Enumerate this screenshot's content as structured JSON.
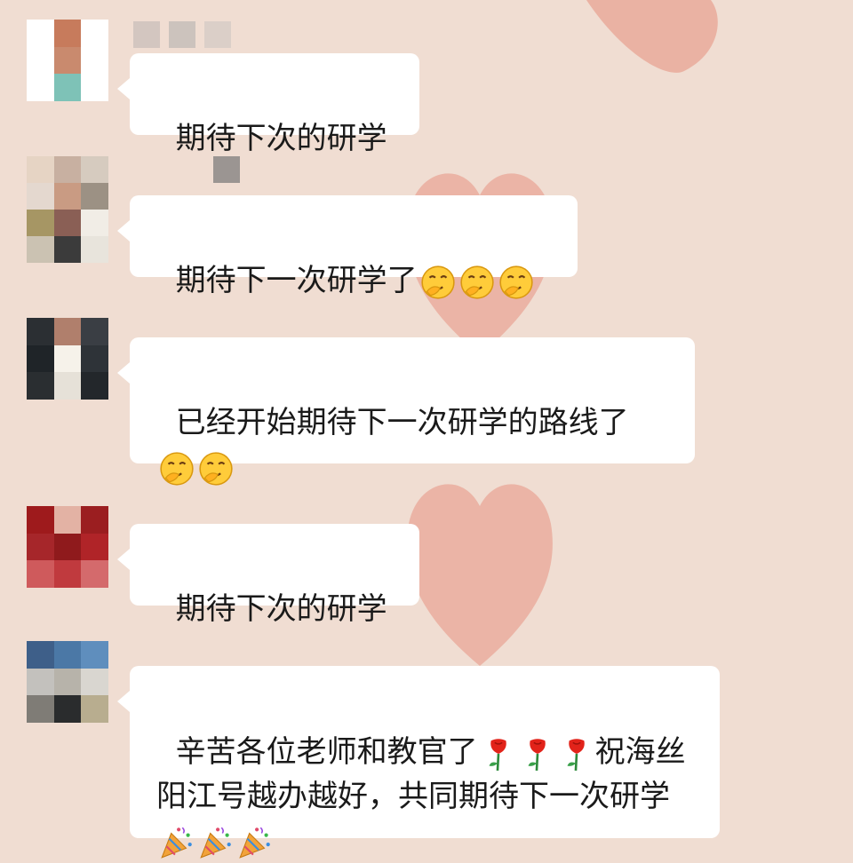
{
  "messages": [
    {
      "text": "期待下次的研学",
      "emoji_name": "",
      "emoji_count": 0,
      "text2": "",
      "emoji2_name": "",
      "emoji2_count": 0
    },
    {
      "text": "期待下一次研学了",
      "emoji_name": "thinking-face-icon",
      "emoji_count": 3,
      "text2": "",
      "emoji2_name": "",
      "emoji2_count": 0
    },
    {
      "text": "已经开始期待下一次研学的路线了",
      "emoji_name": "thinking-face-icon",
      "emoji_count": 2,
      "text2": "",
      "emoji2_name": "",
      "emoji2_count": 0
    },
    {
      "text": "期待下次的研学",
      "emoji_name": "",
      "emoji_count": 0,
      "text2": "",
      "emoji2_name": "",
      "emoji2_count": 0
    },
    {
      "text": "辛苦各位老师和教官了",
      "emoji_name": "rose-icon",
      "emoji_count": 3,
      "text2": "祝海丝阳江号越办越好，共同期待下一次研学",
      "emoji2_name": "party-popper-icon",
      "emoji2_count": 3
    }
  ],
  "colors": {
    "background": "#f0ddd2",
    "heart": "#e8a393",
    "bubble": "#ffffff",
    "text": "#1a1a1a"
  }
}
